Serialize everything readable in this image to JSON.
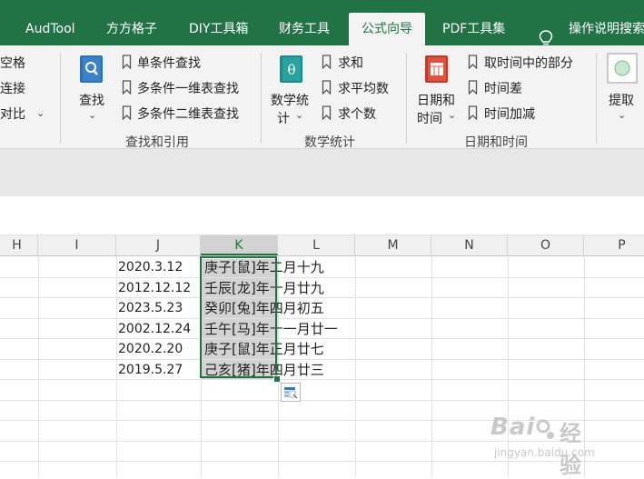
{
  "tabs": [
    {
      "id": "audtool",
      "label": "AudTool"
    },
    {
      "id": "ffgz",
      "label": "方方格子"
    },
    {
      "id": "diy",
      "label": "DIY工具箱"
    },
    {
      "id": "finance",
      "label": "财务工具"
    },
    {
      "id": "formula",
      "label": "公式向导",
      "active": true
    },
    {
      "id": "pdf",
      "label": "PDF工具集"
    },
    {
      "id": "help",
      "label": "操作说明搜索"
    }
  ],
  "ribbon": {
    "left_partial": {
      "items": [
        "空格",
        "连接",
        "对比"
      ]
    },
    "lookup": {
      "big_button": "查找",
      "items": [
        "单条件查找",
        "多条件一维表查找",
        "多条件二维表查找"
      ],
      "title": "查找和引用"
    },
    "stats": {
      "big_button_line1": "数学统",
      "big_button_line2": "计",
      "items": [
        "求和",
        "求平均数",
        "求个数"
      ],
      "title": "数学统计"
    },
    "datetime": {
      "big_button_line1": "日期和",
      "big_button_line2": "时间",
      "items": [
        "取时间中的部分",
        "时间差",
        "时间加减"
      ],
      "title": "日期和时间"
    },
    "extract": {
      "label": "提取"
    }
  },
  "columns": [
    "H",
    "I",
    "J",
    "K",
    "L",
    "M",
    "N",
    "O",
    "P"
  ],
  "selected_column": "K",
  "rows": [
    {
      "date": "2020.3.12",
      "lunar": "庚子[鼠]年二月十九"
    },
    {
      "date": "2012.12.12",
      "lunar": "壬辰[龙]年十月廿九"
    },
    {
      "date": "2023.5.23",
      "lunar": "癸卯[兔]年四月初五"
    },
    {
      "date": "2002.12.24",
      "lunar": "壬午[马]年十一月廿一"
    },
    {
      "date": "2020.2.20",
      "lunar": "庚子[鼠]年正月廿七"
    },
    {
      "date": "2019.5.27",
      "lunar": "己亥[猪]年四月廿三"
    }
  ],
  "watermark": {
    "brand": "Bai",
    "brand2": "经验",
    "url": "jingyan.baidu.com"
  },
  "colors": {
    "accent": "#217346",
    "selection": "#d3d3d3"
  }
}
